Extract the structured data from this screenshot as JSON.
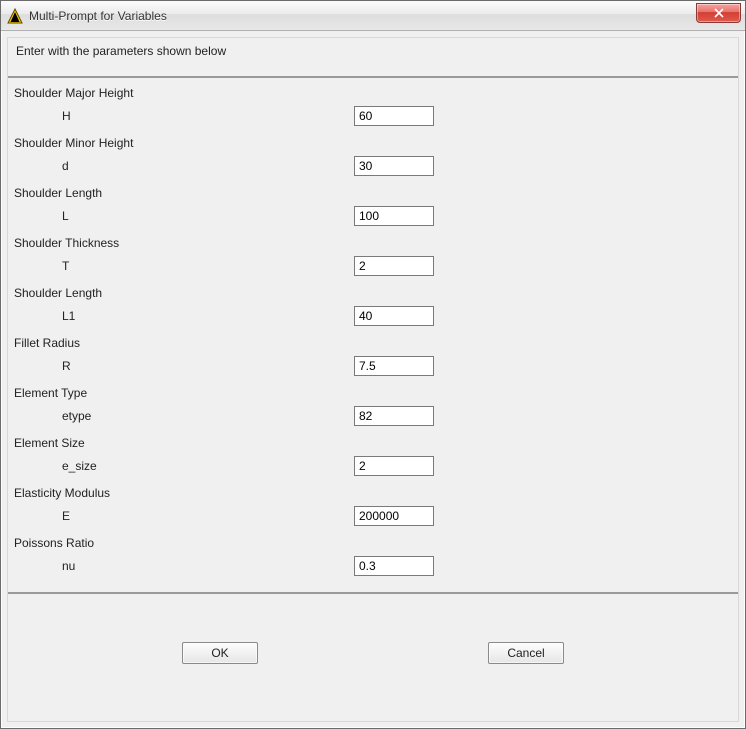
{
  "window": {
    "title": "Multi-Prompt for Variables"
  },
  "instruction": "Enter with the parameters shown below",
  "fields": [
    {
      "label": "Shoulder Major Height",
      "var": "H",
      "value": "60"
    },
    {
      "label": "Shoulder Minor Height",
      "var": "d",
      "value": "30"
    },
    {
      "label": "Shoulder Length",
      "var": "L",
      "value": "100"
    },
    {
      "label": "Shoulder Thickness",
      "var": "T",
      "value": "2"
    },
    {
      "label": "Shoulder Length",
      "var": "L1",
      "value": "40"
    },
    {
      "label": "Fillet Radius",
      "var": "R",
      "value": "7.5"
    },
    {
      "label": "Element Type",
      "var": "etype",
      "value": "82"
    },
    {
      "label": "Element Size",
      "var": "e_size",
      "value": "2"
    },
    {
      "label": "Elasticity Modulus",
      "var": "E",
      "value": "200000"
    },
    {
      "label": "Poissons Ratio",
      "var": "nu",
      "value": "0.3"
    }
  ],
  "buttons": {
    "ok": "OK",
    "cancel": "Cancel"
  }
}
